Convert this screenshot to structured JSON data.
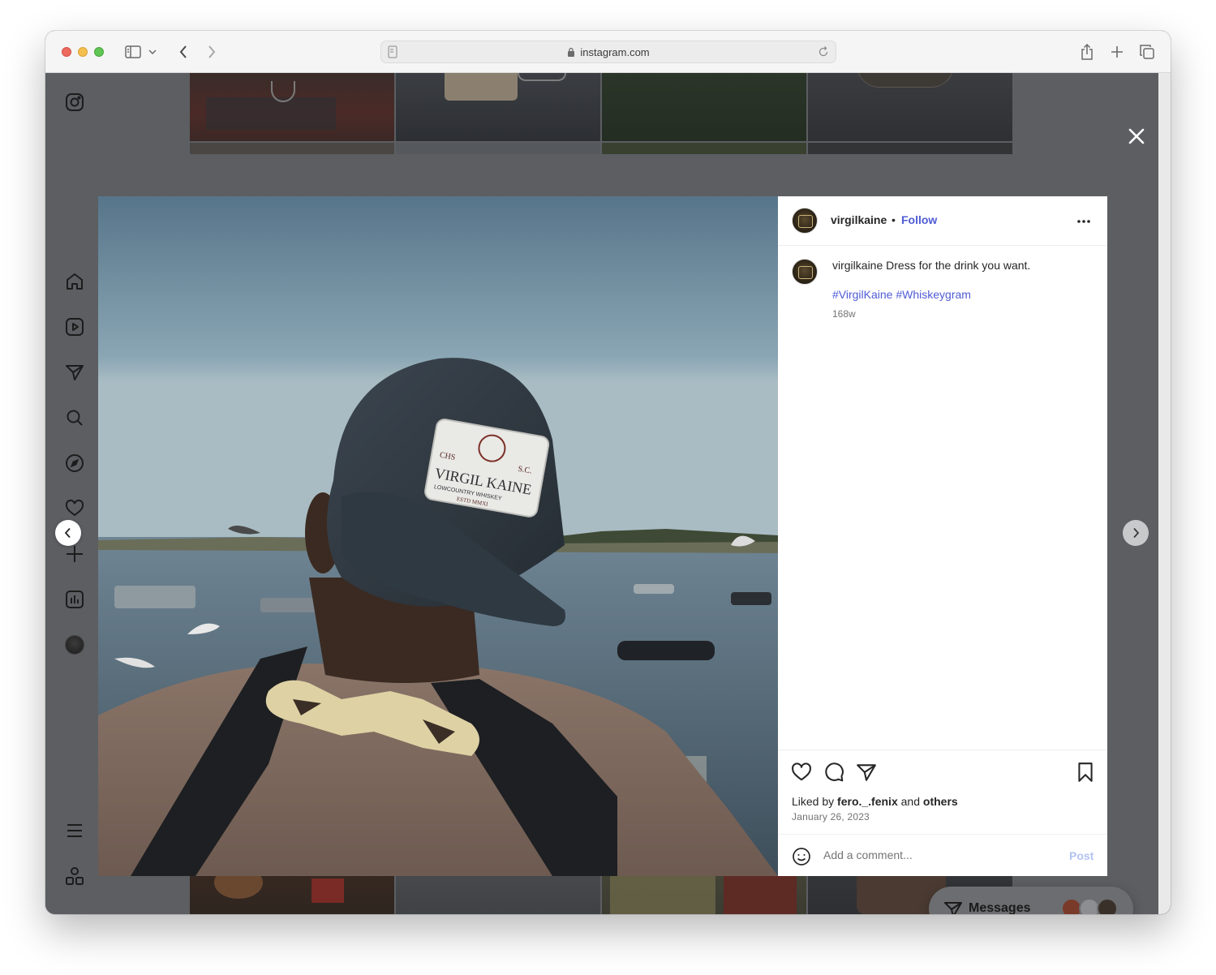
{
  "browser": {
    "url": "instagram.com"
  },
  "post": {
    "username": "virgilkaine",
    "follow_label": "Follow",
    "separator": "•",
    "caption_user": "virgilkaine",
    "caption_text": "Dress for the drink you want.",
    "hashtags": "#VirgilKaine #Whiskeygram",
    "age": "168w",
    "liked_prefix": "Liked by ",
    "liked_user": "fero._.fenix",
    "liked_and": " and ",
    "liked_others": "others",
    "date": "January 26, 2023",
    "comment_placeholder": "Add a comment...",
    "post_label": "Post"
  },
  "photo": {
    "patch_lines": [
      "CHS",
      "S.C.",
      "VIRGIL KAINE",
      "LOWCOUNTRY WHISKEY",
      "ESTD MMXI"
    ]
  },
  "messages": {
    "label": "Messages"
  },
  "icons": {
    "nav": [
      "instagram-icon",
      "home-icon",
      "reels-icon",
      "direct-icon",
      "search-icon",
      "explore-icon",
      "heart-icon",
      "create-icon",
      "insights-icon",
      "profile-avatar",
      "menu-icon",
      "apps-icon"
    ],
    "actions": [
      "heart-icon",
      "comment-icon",
      "share-icon",
      "bookmark-icon"
    ]
  },
  "colors": {
    "link": "#4f5bd5",
    "post_disabled": "#b2c3f4",
    "overlay": "#5c5e62"
  }
}
